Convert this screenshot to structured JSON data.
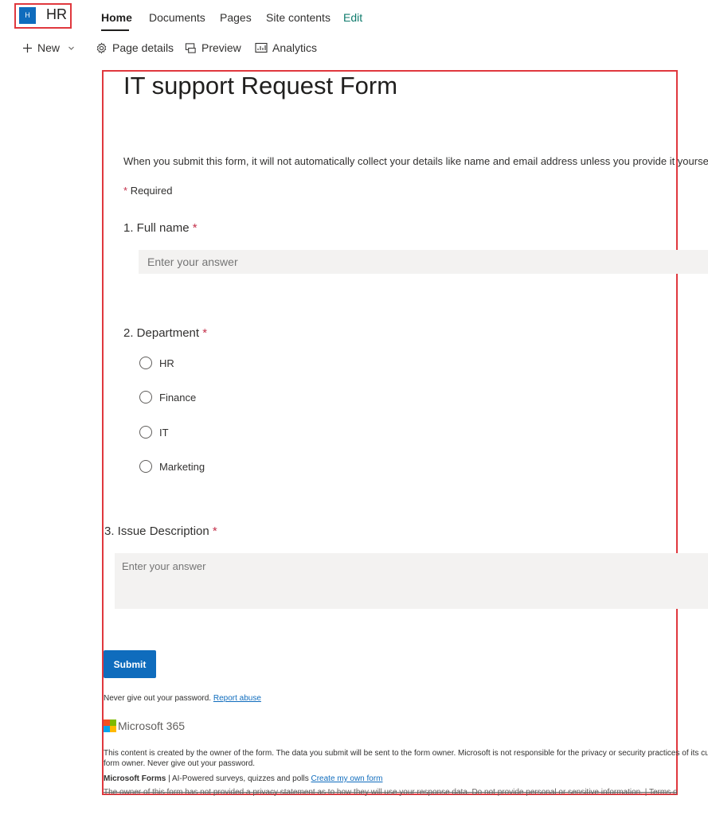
{
  "site": {
    "logo_letter": "H",
    "name": "HR",
    "nav": [
      "Home",
      "Documents",
      "Pages",
      "Site contents",
      "Edit"
    ]
  },
  "commands": {
    "new": "New",
    "page_details": "Page details",
    "preview": "Preview",
    "analytics": "Analytics"
  },
  "form": {
    "title": "IT support Request Form",
    "description": "When you submit this form, it will not automatically collect your details like name and email address unless you provide it yourself.",
    "required_star": "*",
    "required_note": "Required",
    "q1": {
      "title": "1. Full name",
      "placeholder": "Enter your answer"
    },
    "q2": {
      "title": "2. Department",
      "options": [
        "HR",
        "Finance",
        "IT",
        "Marketing"
      ]
    },
    "q3": {
      "title": "3. Issue Description",
      "placeholder": "Enter your answer"
    },
    "submit_label": "Submit"
  },
  "footer": {
    "password_note": "Never give out your password.",
    "report_abuse": "Report abuse",
    "brand": "Microsoft 365",
    "disclaimer_line1": "This content is created by the owner of the form. The data you submit will be sent to the form owner. Microsoft is not responsible for the privacy or security practices of its customers, including those of this",
    "disclaimer_line2": "form owner. Never give out your password.",
    "forms_name": "Microsoft Forms",
    "forms_tagline": "| AI-Powered surveys, quizzes and polls",
    "create_link": "Create my own form",
    "privacy_note": "The owner of this form has not provided a privacy statement as to how they will use your response data. Do not provide personal or sensitive information. | Terms of use"
  },
  "colors": {
    "accent": "#0f6cbd",
    "highlight_border": "#e0383e",
    "required": "#c4314b",
    "ms_logo": [
      "#f25022",
      "#7fba00",
      "#00a4ef",
      "#ffb900"
    ]
  }
}
